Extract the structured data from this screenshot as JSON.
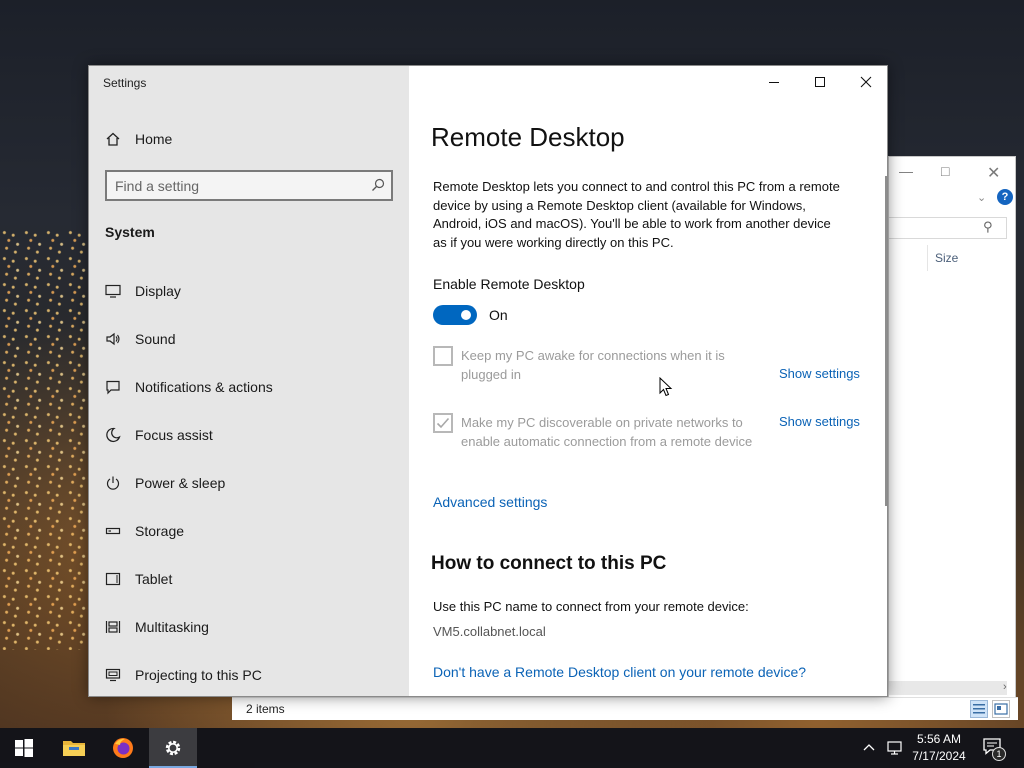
{
  "window": {
    "title": "Settings"
  },
  "sidebar": {
    "home_label": "Home",
    "search_placeholder": "Find a setting",
    "section_label": "System",
    "items": [
      {
        "label": "Display",
        "icon": "monitor-icon"
      },
      {
        "label": "Sound",
        "icon": "speaker-icon"
      },
      {
        "label": "Notifications & actions",
        "icon": "notification-icon"
      },
      {
        "label": "Focus assist",
        "icon": "moon-icon"
      },
      {
        "label": "Power & sleep",
        "icon": "power-icon"
      },
      {
        "label": "Storage",
        "icon": "storage-icon"
      },
      {
        "label": "Tablet",
        "icon": "tablet-icon"
      },
      {
        "label": "Multitasking",
        "icon": "multitasking-icon"
      },
      {
        "label": "Projecting to this PC",
        "icon": "projecting-icon"
      }
    ]
  },
  "content": {
    "title": "Remote Desktop",
    "description": "Remote Desktop lets you connect to and control this PC from a remote device by using a Remote Desktop client (available for Windows, Android, iOS and macOS). You'll be able to work from another device as if you were working directly on this PC.",
    "enable_label": "Enable Remote Desktop",
    "toggle_state": "On",
    "toggle_on": true,
    "option1": {
      "label": "Keep my PC awake for connections when it is plugged in",
      "checked": false,
      "link": "Show settings"
    },
    "option2": {
      "label": "Make my PC discoverable on private networks to enable automatic connection from a remote device",
      "checked": true,
      "link": "Show settings"
    },
    "advanced_link": "Advanced settings",
    "how_title": "How to connect to this PC",
    "pc_name_label": "Use this PC name to connect from your remote device:",
    "pc_name": "VM5.collabnet.local",
    "client_link": "Don't have a Remote Desktop client on your remote device?"
  },
  "explorer": {
    "column_header": "Size",
    "status_items": "2 items"
  },
  "taskbar": {
    "time": "5:56 AM",
    "date": "7/17/2024",
    "notification_count": "1"
  },
  "colors": {
    "accent": "#0067c0",
    "link": "#0b63b6",
    "sidebar_bg": "#e6e6e6",
    "disabled_text": "#9b9b9b"
  }
}
